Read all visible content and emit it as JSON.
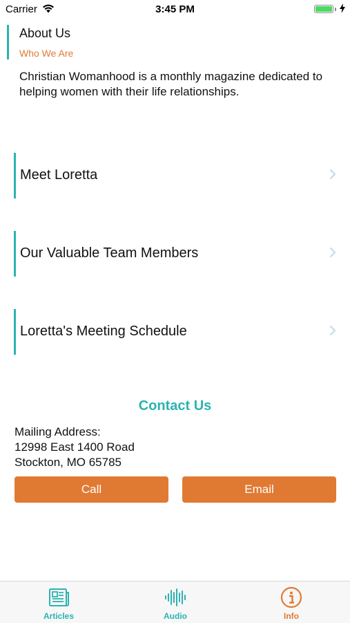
{
  "status_bar": {
    "carrier": "Carrier",
    "time": "3:45 PM"
  },
  "about": {
    "title": "About Us",
    "subtitle": "Who We Are",
    "description": "Christian Womanhood is a monthly magazine dedicated to helping women with their life relationships."
  },
  "nav_rows": [
    {
      "label": "Meet Loretta"
    },
    {
      "label": "Our Valuable Team Members"
    },
    {
      "label": "Loretta's Meeting Schedule"
    }
  ],
  "contact": {
    "title": "Contact Us",
    "address_lines": [
      "Mailing Address:",
      "12998 East 1400 Road",
      "Stockton, MO 65785"
    ],
    "call_label": "Call",
    "email_label": "Email"
  },
  "tabbar": {
    "tabs": [
      {
        "label": "Articles",
        "icon": "newspaper-icon",
        "selected": false
      },
      {
        "label": "Audio",
        "icon": "audio-wave-icon",
        "selected": false
      },
      {
        "label": "Info",
        "icon": "info-icon",
        "selected": true
      }
    ]
  },
  "colors": {
    "accent_teal": "#2ab3b1",
    "accent_orange": "#e07a33"
  }
}
